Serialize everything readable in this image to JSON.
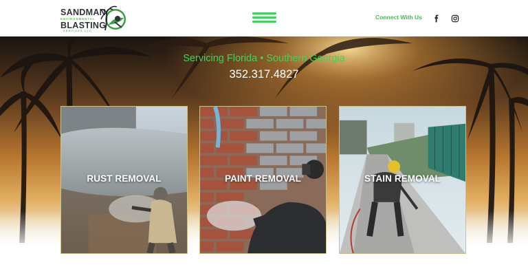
{
  "logo": {
    "line1": "SANDMAN",
    "sub1": "ENVIRONMENTAL",
    "line2": "BLASTING",
    "sub2": "SERVICES LLC"
  },
  "nav": {
    "menu_icon": "hamburger-menu-icon",
    "connect_label": "Connect With Us",
    "social": [
      {
        "icon": "facebook-icon"
      },
      {
        "icon": "instagram-icon"
      }
    ]
  },
  "hero": {
    "tagline": "Servicing Florida • Southern Georgia",
    "phone": "352.317.4827"
  },
  "services": [
    {
      "label": "RUST REMOVAL"
    },
    {
      "label": "PAINT REMOVAL"
    },
    {
      "label": "STAIN REMOVAL"
    }
  ],
  "colors": {
    "accent_green": "#3fd35a",
    "logo_dark": "#2f3336",
    "card_border": "#cbbf8a"
  }
}
